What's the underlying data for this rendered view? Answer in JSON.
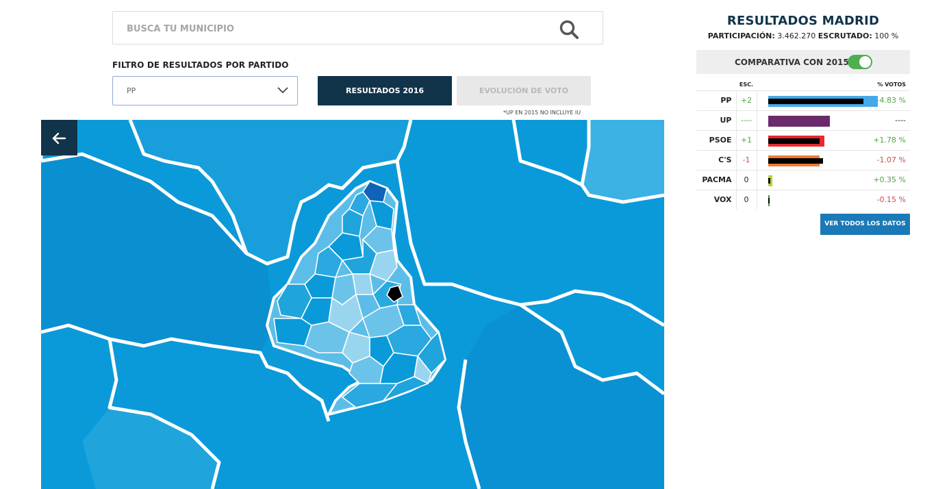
{
  "search": {
    "placeholder": "BUSCA TU MUNICIPIO",
    "icon": "search-icon"
  },
  "filter": {
    "label": "FILTRO DE RESULTADOS POR PARTIDO",
    "selected": "PP",
    "icon": "chevron-down-icon"
  },
  "buttons": {
    "results": "RESULTADOS 2016",
    "evolution": "EVOLUCIÓN DE VOTO"
  },
  "footnote": "*UP EN 2015 NO INCLUYE IU",
  "map": {
    "back_icon": "arrow-left-icon",
    "colors": {
      "dark": "#0a9ad9",
      "mid": "#2aa8e0",
      "light": "#6cc3ea",
      "pale": "#9ad5f0",
      "deep": "#0f63b8",
      "selected": "#000000"
    }
  },
  "results": {
    "title": "RESULTADOS MADRID",
    "participation_label": "PARTICIPACIÓN:",
    "participation_value": "3.462.270",
    "scrutinized_label": "ESCRUTADO:",
    "scrutinized_value": "100 %",
    "compare_label": "COMPARATIVA CON 2015",
    "compare_on": true,
    "col_esc": "ESC.",
    "col_votes": "% VOTOS",
    "parties": [
      {
        "name": "PP",
        "esc": "+2",
        "esc_class": "pos",
        "pct": "+4.83 %",
        "pct_class": "pos",
        "color": "#44a9e8",
        "share2015": 0.94,
        "share2016": 0.82
      },
      {
        "name": "UP",
        "esc": "----",
        "esc_class": "pos",
        "pct": "----",
        "pct_class": "neu",
        "color": "#6b2b6b",
        "share2015": 0.53,
        "share2016": 0.0
      },
      {
        "name": "PSOE",
        "esc": "+1",
        "esc_class": "pos",
        "pct": "+1.78 %",
        "pct_class": "pos",
        "color": "#e8282e",
        "share2015": 0.48,
        "share2016": 0.44
      },
      {
        "name": "C'S",
        "esc": "-1",
        "esc_class": "neg",
        "pct": "-1.07 %",
        "pct_class": "neg",
        "color": "#ef7b32",
        "share2015": 0.44,
        "share2016": 0.47
      },
      {
        "name": "PACMA",
        "esc": "0",
        "esc_class": "neu",
        "pct": "+0.35 %",
        "pct_class": "pos",
        "color": "#b9d132",
        "share2015": 0.035,
        "share2016": 0.02
      },
      {
        "name": "VOX",
        "esc": "0",
        "esc_class": "neu",
        "pct": "-0.15 %",
        "pct_class": "neg",
        "color": "#3c9e43",
        "share2015": 0.01,
        "share2016": 0.012
      }
    ],
    "all_data_button": "VER TODOS LOS DATOS"
  }
}
